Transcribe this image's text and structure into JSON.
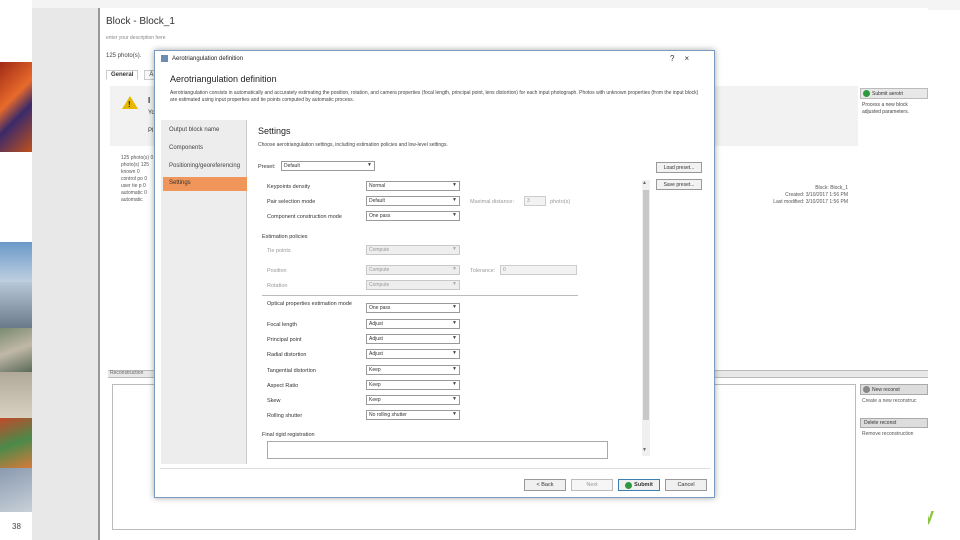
{
  "slide": {
    "number": "38",
    "logo": "y"
  },
  "app": {
    "title": "Block - Block_1",
    "subtitle": "enter your description here",
    "photo_count": "125 photo(s). ",
    "tabs": [
      "General",
      "Ä"
    ],
    "warning_lines": [
      "I",
      "Yo",
      "Pl"
    ],
    "left_info": "125 photo(s) 0 photo(s) 125 known 0 control po 0 user tie p 0 automatic 0 automatic",
    "submit_label": "Submit aerotri",
    "right_text": "Process a new block adjusted parameters.",
    "props": [
      "Block: Block_1",
      "Created: 3/10/2017 1:56 PM",
      "Last modified: 3/10/2017 1:56 PM"
    ],
    "split_label": "Reconstruction",
    "new_button": "New reconst",
    "new_text": "Create a new reconstruc",
    "delete_button": "Delete reconst",
    "delete_text": "Remove reconstruction"
  },
  "dialog": {
    "window_title": "Aerotriangulation definition",
    "controls": {
      "help": "?",
      "close": "×"
    },
    "heading": "Aerotriangulation definition",
    "description": "Aerotriangulation consists in automatically and accurately estimating the position, rotation, and camera properties (focal length, principal point, lens distortion) for each input photograph. Photos with unknown properties (from the input block) are estimated using input properties and tie points computed by automatic process.",
    "nav": [
      "Output block name",
      "Components",
      "Positioning/georeferencing",
      "Settings"
    ],
    "active_nav": "Settings",
    "pane_title": "Settings",
    "pane_desc": "Choose aerotriangulation settings, including estimation policies and low-level settings.",
    "preset_label": "Preset:",
    "preset_value": "Default",
    "load_preset": "Load preset...",
    "save_preset": "Save preset...",
    "rows": {
      "keypoints": {
        "label": "Keypoints density",
        "value": "Normal"
      },
      "pair_selection": {
        "label": "Pair selection mode",
        "value": "Default",
        "extra_label": "Maximal distance:",
        "extra_value": "3",
        "extra_unit": "photo(s)"
      },
      "components_mode": {
        "label": "Component construction mode",
        "value": "One pass"
      },
      "estimation_policies": "Estimation policies",
      "tie_points": {
        "label": "Tie points",
        "value": "Compute"
      },
      "position": {
        "label": "Position",
        "value": "Compute",
        "extra_label": "Tolerance:",
        "extra_value": "0"
      },
      "rotation": {
        "label": "Rotation",
        "value": "Compute"
      },
      "optical_mode": {
        "label": "Optical properties estimation mode",
        "value": "One pass"
      },
      "focal_length": {
        "label": "Focal length",
        "value": "Adjust"
      },
      "principal_point": {
        "label": "Principal point",
        "value": "Adjust"
      },
      "radial_distortion": {
        "label": "Radial distortion",
        "value": "Adjust"
      },
      "tangential_distortion": {
        "label": "Tangential distortion",
        "value": "Keep"
      },
      "aspect_ratio": {
        "label": "Aspect Ratio",
        "value": "Keep"
      },
      "skew": {
        "label": "Skew",
        "value": "Keep"
      },
      "rolling_shutter": {
        "label": "Rolling shutter",
        "value": "No rolling shutter"
      },
      "final_rigid": {
        "label": "Final rigid registration"
      }
    },
    "footer": {
      "back": "< Back",
      "next": "Next",
      "submit": "Submit",
      "cancel": "Cancel"
    }
  }
}
